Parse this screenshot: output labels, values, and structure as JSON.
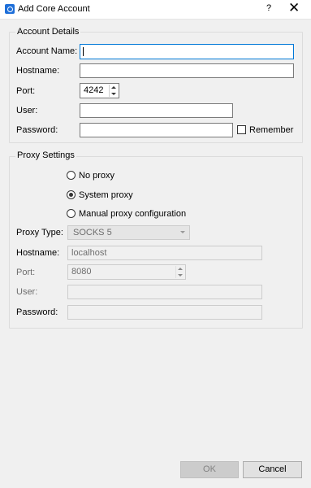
{
  "window": {
    "title": "Add Core Account",
    "help_label": "?",
    "close_label": "✕",
    "app_icon": "app-icon",
    "accent_color": "#0078d7"
  },
  "account": {
    "group_title": "Account Details",
    "account_name_label": "Account Name:",
    "account_name_value": "",
    "hostname_label": "Hostname:",
    "hostname_value": "",
    "port_label": "Port:",
    "port_value": "4242",
    "user_label": "User:",
    "user_value": "",
    "password_label": "Password:",
    "password_value": "",
    "remember_label": "Remember",
    "remember_checked": false
  },
  "proxy": {
    "group_title": "Proxy Settings",
    "options": [
      {
        "label": "No proxy",
        "checked": false
      },
      {
        "label": "System proxy",
        "checked": true
      },
      {
        "label": "Manual proxy configuration",
        "checked": false
      }
    ],
    "type_label": "Proxy Type:",
    "type_value": "SOCKS 5",
    "hostname_label": "Hostname:",
    "hostname_value": "localhost",
    "port_label": "Port:",
    "port_value": "8080",
    "user_label": "User:",
    "user_value": "",
    "password_label": "Password:",
    "password_value": ""
  },
  "buttons": {
    "ok_label": "OK",
    "ok_enabled": false,
    "cancel_label": "Cancel"
  }
}
